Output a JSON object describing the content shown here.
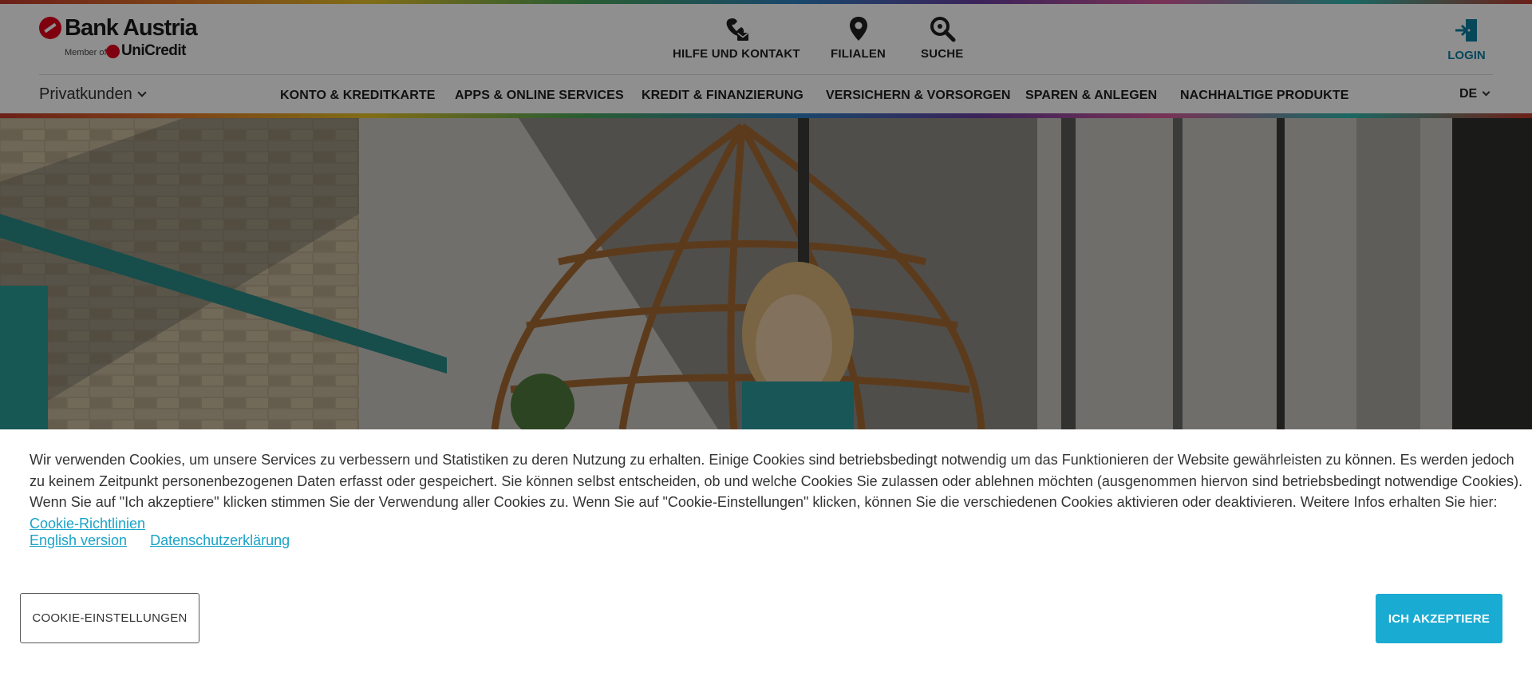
{
  "brand": {
    "name": "Bank Austria",
    "member_of": "Member of",
    "parent": "UniCredit"
  },
  "utility_nav": [
    {
      "label": "HILFE UND KONTAKT",
      "icon": "help-contact-icon"
    },
    {
      "label": "FILIALEN",
      "icon": "location-pin-icon"
    },
    {
      "label": "SUCHE",
      "icon": "search-icon"
    }
  ],
  "login": {
    "label": "LOGIN",
    "icon": "login-icon"
  },
  "segment_selector": {
    "label": "Privatkunden"
  },
  "main_nav": [
    "KONTO & KREDITKARTE",
    "APPS & ONLINE SERVICES",
    "KREDIT & FINANZIERUNG",
    "VERSICHERN & VORSORGEN",
    "SPAREN & ANLEGEN",
    "NACHHALTIGE PRODUKTE"
  ],
  "language": {
    "label": "DE"
  },
  "colors": {
    "accent": "#1aabd2",
    "link": "#1aa3c8",
    "login": "#0b7fa1",
    "brand_red": "#e2001a"
  },
  "cookie_banner": {
    "text": "Wir verwenden Cookies, um unsere Services zu verbessern und Statistiken zu deren Nutzung zu erhalten. Einige Cookies sind betriebsbedingt notwendig um das Funktionieren der Website gewährleisten zu können. Es werden jedoch zu keinem Zeitpunkt personenbezogenen Daten erfasst oder gespeichert. Sie können selbst entscheiden, ob und welche Cookies Sie zulassen oder ablehnen möchten (ausgenommen hiervon sind betriebsbedingt notwendige Cookies). Wenn Sie auf \"Ich akzeptiere\" klicken stimmen Sie der Verwendung aller Cookies zu. Wenn Sie auf \"Cookie-Einstellungen\" klicken, können Sie die verschiedenen Cookies aktivieren oder deaktivieren. Weitere Infos erhalten Sie hier:",
    "policy_link": "Cookie-Richtlinien",
    "english_link": "English version",
    "privacy_link": "Datenschutzerklärung",
    "settings_button": "COOKIE-EINSTELLUNGEN",
    "accept_button": "ICH AKZEPTIERE"
  }
}
